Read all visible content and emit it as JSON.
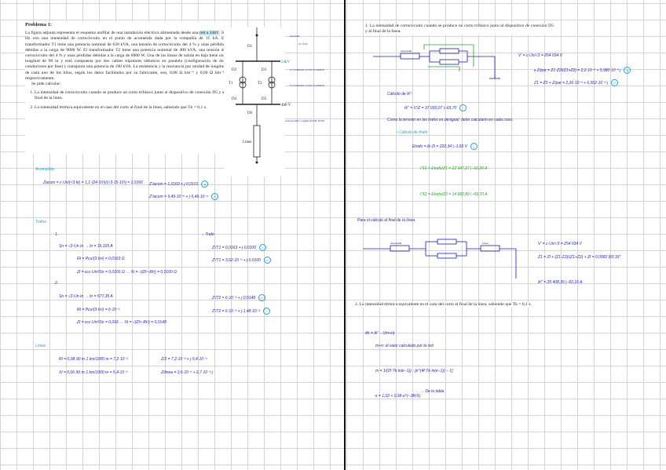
{
  "problem": {
    "title": "Problema 1:",
    "text_before": "La figura adjunta representa el esquema unifilar de una instalación eléctrica alimentada desde una ",
    "highlight": "red a 24kV",
    "text_after": ", 50 Hz con una intensidad de cortocircuito en el punto de acometida dada por la compañía de 15 kA. El transformador T1 tiene una potencia nominal de 630 kVA, una tensión de cortocircuito del 4 % y unas pérdidas debidas a la carga de 9000 W. El transformador T2 tiene una potencia nominal de 400 kVA, una tensión de cortocircuito del 4 % y unas pérdidas debidas a la carga de 6000 W. Una de las líneas de salida en baja tiene una longitud de 90 m y está compuesta por dos cables tripolares idénticos en paralelo (configuración de dos conductores por fase) y transporta una potencia de 190 kVA. La resistencia y la reactancia por unidad de longitud de cada uno de los hilos, según los datos facilitados por su fabricante, son, 0,08 Ω km⁻¹ y 0,06 Ω km⁻¹, respectivamente.",
    "ask": "Se pide calcular:",
    "q1": "La intensidad de cortocircuito cuando se produce un corto trifásico junto al dispositivo de conexión D5 y al final de la línea.",
    "q2": "La intensidad térmica equivalente en el caso del corto al final de la línea, sabiendo que Tk = 0,1 s."
  },
  "diagram": {
    "d1": "D1",
    "d2": "D2",
    "d3": "D3",
    "d4": "D4",
    "d5": "D5",
    "d6": "D6",
    "t1": "T1",
    "t2": "T2",
    "bus_hv": "24kV",
    "bus_lv": "400 V",
    "line": "Línea",
    "notes": [
      "Acometida",
      "Ik = 15 kA",
      "T1: Sn=630 kVA, εcc=4%, Pcu=9000 W",
      "T2: Sn=400 kVA, εcc=4%, Pcu=6000 W",
      "Línea: long=90 m, 2 cables, Rl=0,08, Xl=0,06"
    ]
  },
  "left_notes": {
    "acometida": "Acometida:",
    "acom_eq": "Zacom = c·Un/(√3·Ik) = 1,1·(24·10³)/(√3·15·10³) = 1,0160",
    "acom_r1": "Z'/acom = 1,0160 + j·0,0101",
    "acom_r2": "Z'/acom = 5,49·10⁻⁵ + j·5,46·10⁻⁴",
    "trafos": "Trafos:",
    "trafo_label": "→ Trafo",
    "t1": "1.",
    "t1_lines": [
      "Sn = √3·Un·In → In = 15,155 A",
      "Rt = Pcu/(3·In²) = 0,0163 Ω",
      "Zt = εcc·Un²/Sn = 0,0101 Ω  →  Xt = √(Zt²−Rt²) = 0,0100 Ω"
    ],
    "t1_res": [
      "Z'/T1 = 0,0163 + j·0,0100",
      "Z'/T1 = 3,62·10⁻³ + j·0,0100"
    ],
    "t2": "2.",
    "t2_lines": [
      "Sn = √3·Un·In → In = 577,35 A",
      "Rt = Pcu/(3·In²) = 6·10⁻³",
      "Zt = εcc·Un²/Sn = 0,016  →  Xt = √(Zt²−Rt²) = 0,0148"
    ],
    "t2_res": [
      "Z'/T2 = 6·10⁻³ + j·0,0148",
      "Z'/T2 = 6·10⁻³ + j·1,48·10⁻²"
    ],
    "linea": "Línea:",
    "l_lines": [
      "Rl = 0,08·90 m·1 km/1000 m = 7,2·10⁻³",
      "Xl = 0,06·90 m·1 km/1000 m = 5,4·10⁻³"
    ],
    "l_res": [
      "Z/2 = 7,2·10⁻³ + j·5,4·10⁻³",
      "Z/linea = 3,6·10⁻³ + 2,7·10⁻³ j"
    ]
  },
  "right_notes": {
    "q1": "La intensidad de cortocircuito cuando se produce un corto trifásico junto al dispositivo de conexión D5 y al final de la línea.",
    "acometida": "Acometida",
    "v_eq": "V' = c·Un/√3 = 254 034 V",
    "z_par": "Z/par = Z1·Z2/(Z1+Z2) = 2,2·10⁻³ + 5,980·10⁻³ j",
    "z_tot": "Z1 = Z0 + Z/par = 2,26·10⁻³ + 6,502·10⁻³ j",
    "calc_ik": "Cálculo de Ik'':",
    "ik_eq": "Ik'' = V'/Z = 37 030,07 |−69,70",
    "comment": "Como la tensión en las trafos es desigual, debo calcularlo en cada caso.",
    "calc_t": "• Cálculo de Itrafo",
    "e_eq": "Etrafo = Ik·Zt = 222,34 |−1,82  V",
    "i1": "I''k1 = Etrafo/Z1 = 22 347,27 |−69,20 A",
    "i2": "I''k2 = Etrafo/Z2 = 14 682,89 |−69,70 A",
    "final": "Para el cálculo al final de la línea.",
    "linea": "Línea",
    "v2": "V' = c·Un/√3 = 254 034 V",
    "z2": "Z1 = Zl + (Z1·Z2)/(Z1+Z2) + Zl = 0,0082 |60,16°",
    "ik2": "Ik'' = 29 408,35 |−60,16 A",
    "q2": "La intensidad térmica equivalente en el caso del corto al final de la línea, sabiendo que Tk = 0,1 s.",
    "ith": "Ith = Ik'' · √(m+n)",
    "ith_note": "m+n: el valor calculado por la red",
    "m_eq": "m = 1/(2f·Tk·ln(κ−1)) · [e^(4f·Tk·ln(κ−1)) − 1]",
    "k_eq": "κ = 1,02 + 0,98·e^(−3R/X)",
    "k_note": "→ De la tabla"
  }
}
